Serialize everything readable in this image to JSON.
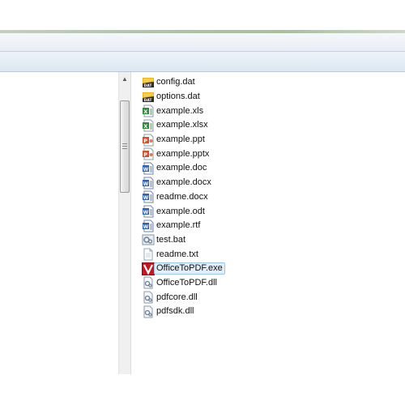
{
  "colors": {
    "title_stripe": "#b0c2a8",
    "selection_fill": "#e1eefb",
    "selection_border": "#9cc5ec"
  },
  "files": [
    {
      "name": "config.dat",
      "icon": "dat-file-icon"
    },
    {
      "name": "options.dat",
      "icon": "dat-file-icon"
    },
    {
      "name": "example.xls",
      "icon": "excel-file-icon"
    },
    {
      "name": "example.xlsx",
      "icon": "excel-file-icon"
    },
    {
      "name": "example.ppt",
      "icon": "powerpoint-file-icon"
    },
    {
      "name": "example.pptx",
      "icon": "powerpoint-file-icon"
    },
    {
      "name": "example.doc",
      "icon": "word-file-icon"
    },
    {
      "name": "example.docx",
      "icon": "word-file-icon"
    },
    {
      "name": "readme.docx",
      "icon": "word-file-icon"
    },
    {
      "name": "example.odt",
      "icon": "word-file-icon"
    },
    {
      "name": "example.rtf",
      "icon": "word-file-icon"
    },
    {
      "name": "test.bat",
      "icon": "batch-file-icon"
    },
    {
      "name": "readme.txt",
      "icon": "text-file-icon"
    },
    {
      "name": "OfficeToPDF.exe",
      "icon": "officetopdf-app-icon",
      "selected": true
    },
    {
      "name": "OfficeToPDF.dll",
      "icon": "dll-file-icon"
    },
    {
      "name": "pdfcore.dll",
      "icon": "dll-file-icon"
    },
    {
      "name": "pdfsdk.dll",
      "icon": "dll-file-icon"
    }
  ]
}
